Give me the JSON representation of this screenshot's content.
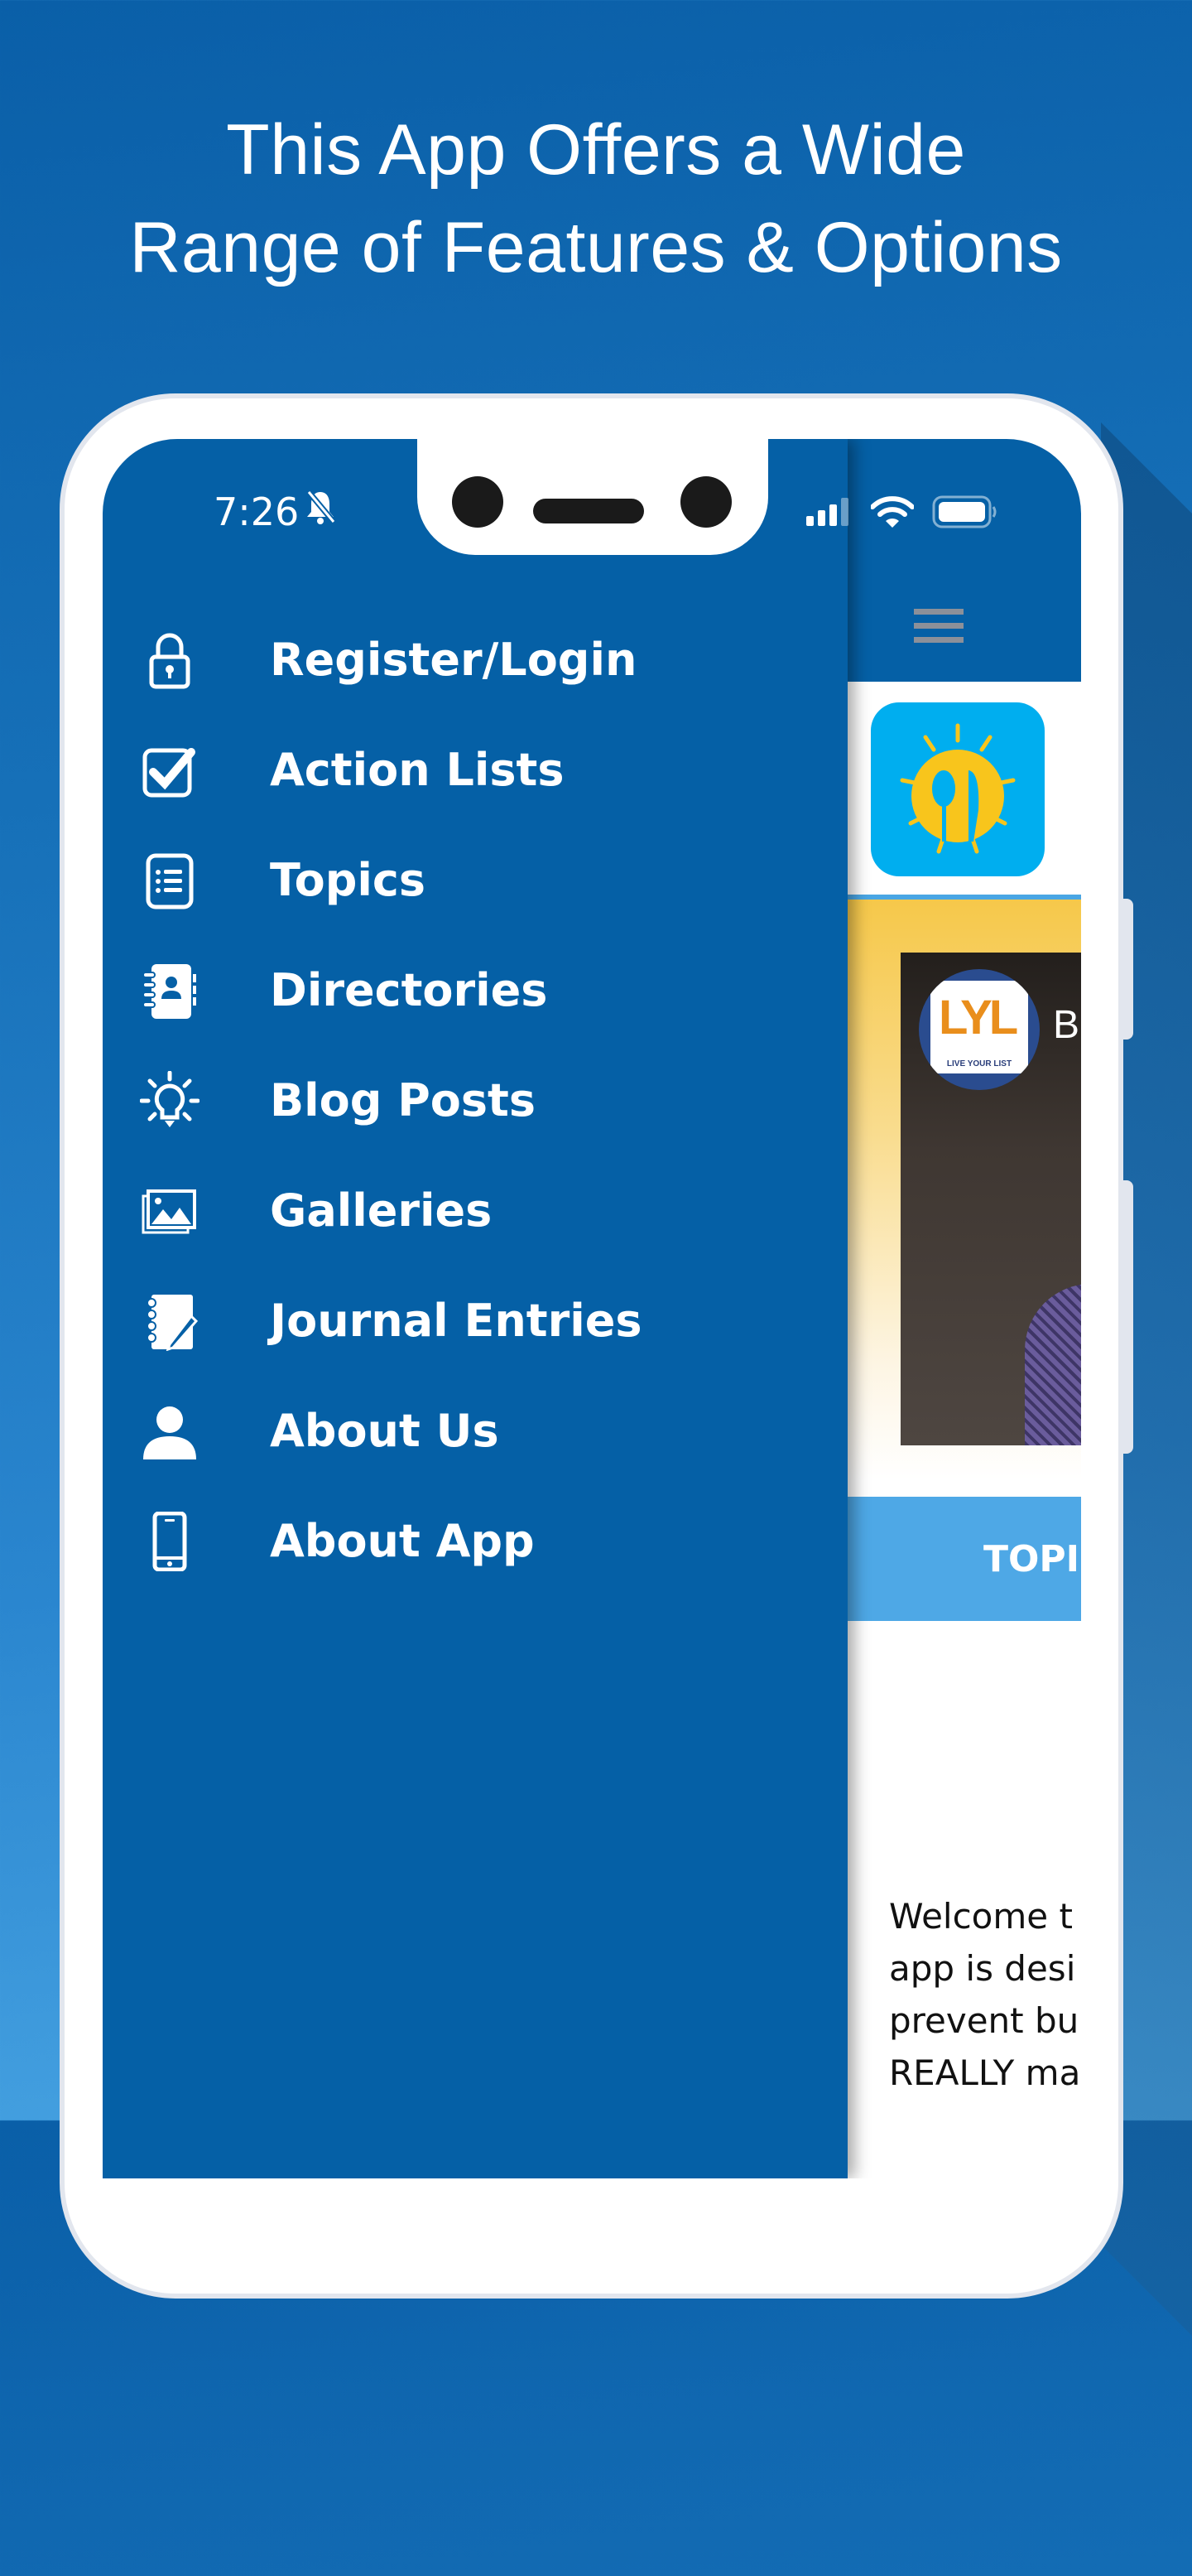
{
  "headline": {
    "line1": "This App Offers a Wide",
    "line2": "Range of Features & Options"
  },
  "status_bar": {
    "time": "7:26",
    "icons": [
      "bell-slash-icon",
      "signal-icon",
      "wifi-icon",
      "battery-icon"
    ]
  },
  "drawer": {
    "items": [
      {
        "label": "Register/Login",
        "icon": "lock-icon"
      },
      {
        "label": "Action Lists",
        "icon": "checkbox-icon"
      },
      {
        "label": "Topics",
        "icon": "list-icon"
      },
      {
        "label": "Directories",
        "icon": "address-book-icon"
      },
      {
        "label": "Blog Posts",
        "icon": "lightbulb-icon"
      },
      {
        "label": "Galleries",
        "icon": "image-gallery-icon"
      },
      {
        "label": "Journal Entries",
        "icon": "journal-icon"
      },
      {
        "label": "About Us",
        "icon": "user-icon"
      },
      {
        "label": "About App",
        "icon": "smartphone-icon"
      }
    ]
  },
  "app_behind": {
    "menu_icon": "hamburger-icon",
    "logo_icon": "sun-spoon-knife-icon",
    "video": {
      "channel_logo_letters": "LYL",
      "channel_logo_tagline": "LIVE YOUR LIST",
      "title_partial": "B"
    },
    "topics_band_label": "TOPI",
    "welcome_lines": [
      "Welcome t",
      "app is desi",
      "prevent bu",
      "REALLY ma"
    ]
  },
  "colors": {
    "drawer_bg": "#0560a6",
    "topics_band": "#4ea8e6",
    "logo_bg": "#00aeef",
    "logo_sun": "#f8c51c",
    "promo_yellow": "#f6c84a"
  }
}
